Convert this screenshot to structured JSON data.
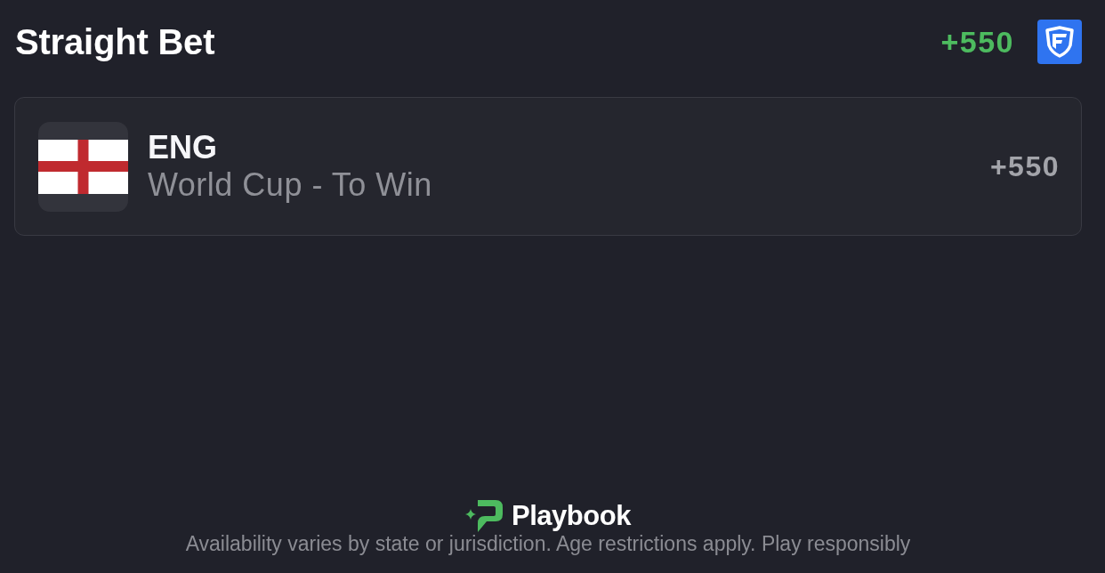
{
  "header": {
    "title": "Straight Bet",
    "odds": "+550"
  },
  "bet": {
    "team": "ENG",
    "market": "World Cup - To Win",
    "odds": "+550"
  },
  "footer": {
    "brand": "Playbook",
    "disclaimer": "Availability varies by state or jurisdiction. Age restrictions apply. Play responsibly"
  }
}
